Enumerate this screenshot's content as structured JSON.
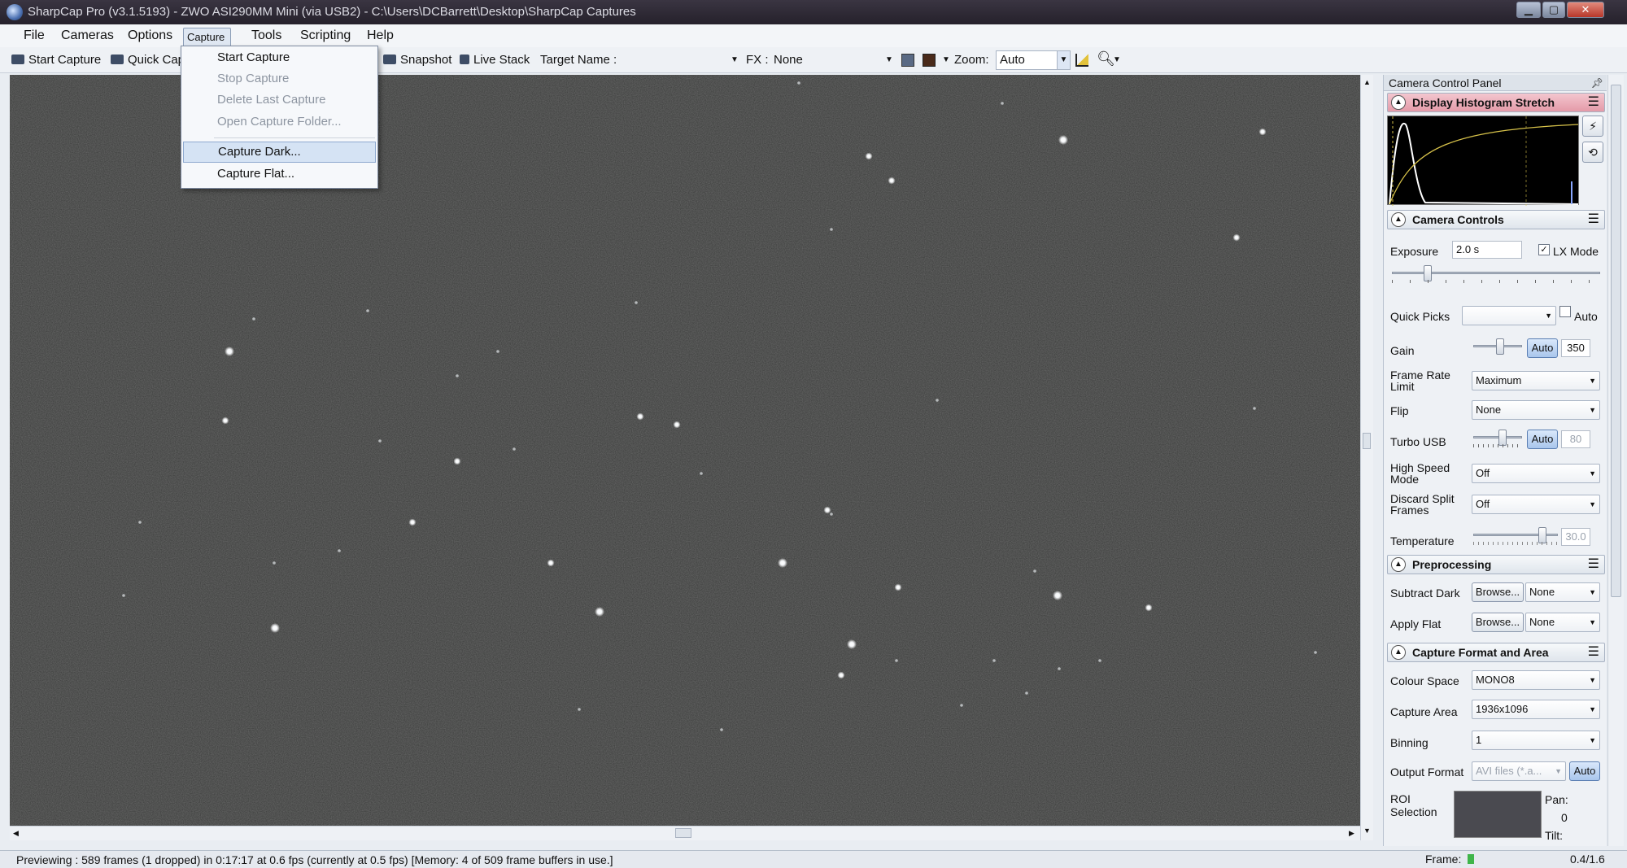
{
  "window": {
    "title": "SharpCap Pro (v3.1.5193) - ZWO ASI290MM Mini (via USB2) - C:\\Users\\DCBarrett\\Desktop\\SharpCap Captures",
    "min_glyph": "▁",
    "max_glyph": "▢",
    "close_glyph": "✕"
  },
  "menubar": [
    "File",
    "Cameras",
    "Options",
    "Capture",
    "Tools",
    "Scripting",
    "Help"
  ],
  "toolbar": {
    "start_capture": "Start Capture",
    "quick_capture": "Quick Cap",
    "snapshot": "Snapshot",
    "live_stack": "Live Stack",
    "target_name_label": "Target Name :",
    "fx_label": "FX :",
    "fx_value": "None",
    "zoom_label": "Zoom:",
    "zoom_value": "Auto"
  },
  "capture_menu": {
    "items": [
      {
        "label": "Start Capture",
        "enabled": true
      },
      {
        "label": "Stop Capture",
        "enabled": false
      },
      {
        "label": "Delete Last Capture",
        "enabled": false
      },
      {
        "label": "Open Capture Folder...",
        "enabled": false
      },
      {
        "label": "Capture Dark...",
        "enabled": true,
        "highlighted": true
      },
      {
        "label": "Capture Flat...",
        "enabled": true
      }
    ]
  },
  "panel": {
    "title": "Camera Control Panel",
    "sections": {
      "histogram": "Display Histogram Stretch",
      "camera_controls": "Camera Controls",
      "preprocessing": "Preprocessing",
      "capture_format": "Capture Format and Area"
    },
    "exposure": {
      "label": "Exposure",
      "value": "2.0 s",
      "lx_mode_label": "LX Mode",
      "lx_mode_checked": true,
      "slider_fraction": 0.16
    },
    "quick_picks": {
      "label": "Quick Picks",
      "value": "",
      "auto_label": "Auto"
    },
    "gain": {
      "label": "Gain",
      "auto_label": "Auto",
      "value": "350",
      "slider_fraction": 0.55
    },
    "frame_rate_limit": {
      "label": "Frame Rate Limit",
      "value": "Maximum"
    },
    "flip": {
      "label": "Flip",
      "value": "None"
    },
    "turbo_usb": {
      "label": "Turbo USB",
      "auto_label": "Auto",
      "value": "80",
      "slider_fraction": 0.62
    },
    "high_speed_mode": {
      "label": "High Speed Mode",
      "value": "Off"
    },
    "discard_split_frames": {
      "label": "Discard Split Frames",
      "value": "Off"
    },
    "temperature": {
      "label": "Temperature",
      "value": "30.0",
      "slider_fraction": 0.85
    },
    "subtract_dark": {
      "label": "Subtract Dark",
      "browse_label": "Browse...",
      "value": "None"
    },
    "apply_flat": {
      "label": "Apply Flat",
      "browse_label": "Browse...",
      "value": "None"
    },
    "colour_space": {
      "label": "Colour Space",
      "value": "MONO8"
    },
    "capture_area": {
      "label": "Capture Area",
      "value": "1936x1096"
    },
    "binning": {
      "label": "Binning",
      "value": "1"
    },
    "output_format": {
      "label": "Output Format",
      "value": "AVI files (*.a...",
      "auto_label": "Auto"
    },
    "roi": {
      "label": "ROI Selection",
      "pan_label": "Pan:",
      "pan_value": "0",
      "tilt_label": "Tilt:"
    }
  },
  "statusbar": {
    "text": "Previewing : 589 frames (1 dropped) in 0:17:17 at 0.6 fps  (currently at 0.5 fps) [Memory: 4 of 509 frame buffers in use.]",
    "frame_label": "Frame:",
    "frame_value": "0.4/1.6"
  },
  "colors": {
    "sky": "#3a3b3a",
    "menu_highlight": "#d5e3f4",
    "histogram_header": "#e49aa8"
  }
}
